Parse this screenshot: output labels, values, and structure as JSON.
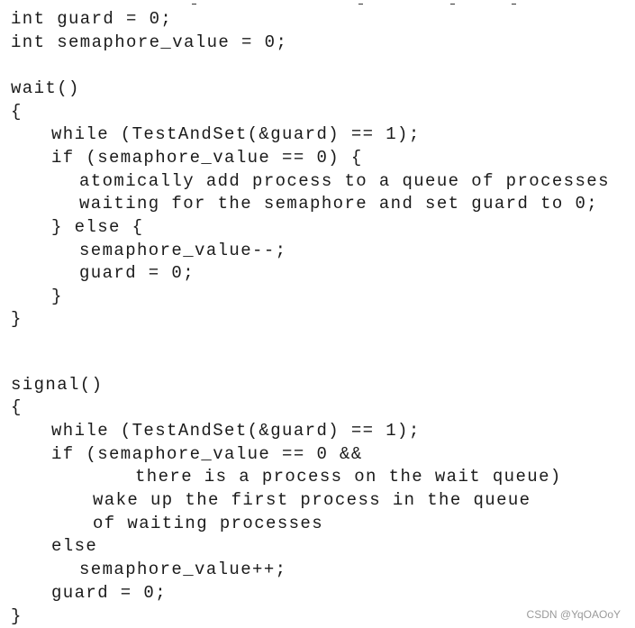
{
  "code_lines": [
    "int guard = 0;",
    "int semaphore_value = 0;",
    "wait()",
    "{",
    "while (TestAndSet(&guard) == 1);",
    "if (semaphore_value == 0) {",
    "atomically add process to a queue of processes",
    "waiting for the semaphore and set guard to 0;",
    "} else {",
    "semaphore_value--;",
    "guard = 0;",
    "}",
    "}",
    "signal()",
    "{",
    "while (TestAndSet(&guard) == 1);",
    "if (semaphore_value == 0 &&",
    "there is a process on the wait queue)",
    "wake up the first process in the queue",
    "of waiting processes",
    "else",
    "semaphore_value++;",
    "guard = 0;",
    "}"
  ],
  "watermark": "CSDN @YqOAOoY"
}
